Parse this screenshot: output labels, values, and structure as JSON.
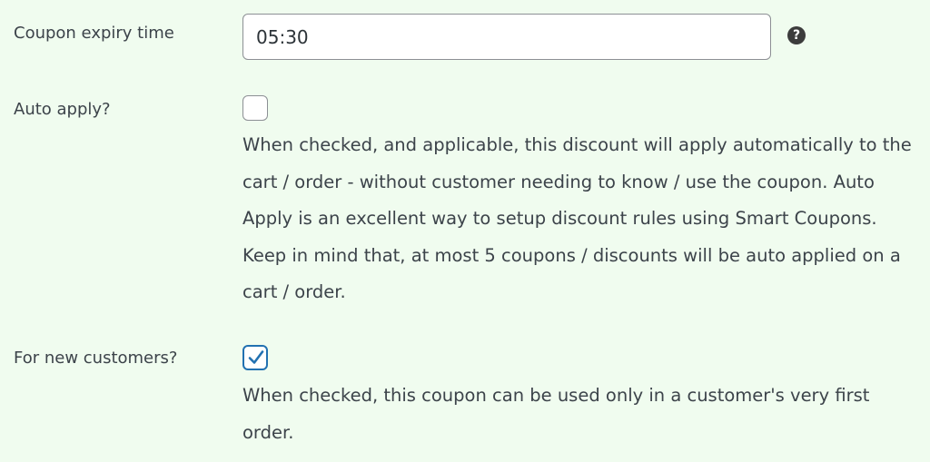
{
  "coupon_expiry": {
    "label": "Coupon expiry time",
    "value": "05:30",
    "help_icon": "question-circle-icon"
  },
  "auto_apply": {
    "label": "Auto apply?",
    "checked": false,
    "description": "When checked, and applicable, this discount will apply automatically to the cart / order - without customer needing to know / use the coupon. Auto Apply is an excellent way to setup discount rules using Smart Coupons. Keep in mind that, at most 5 coupons / discounts will be auto applied on a cart / order."
  },
  "new_customers": {
    "label": "For new customers?",
    "checked": true,
    "description": "When checked, this coupon can be used only in a customer's very first order."
  },
  "colors": {
    "background": "#f0fcef",
    "accent": "#2271b1",
    "text": "#3c434a"
  }
}
